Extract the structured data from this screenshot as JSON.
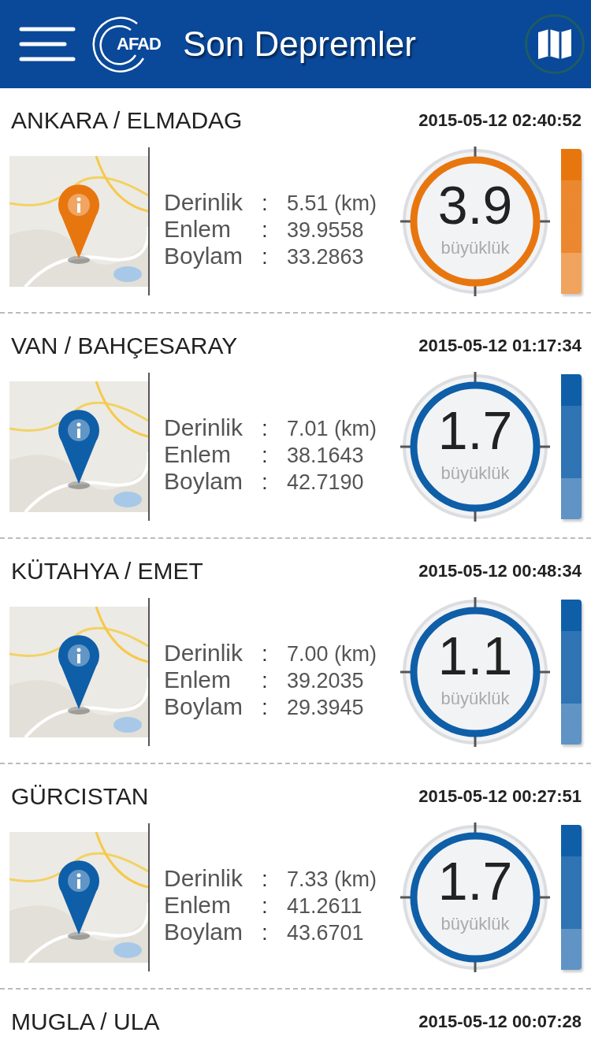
{
  "header": {
    "logo_text": "AFAD",
    "title": "Son Depremler"
  },
  "quakes": [
    {
      "place": "ANKARA / ELMADAG",
      "time": "2015-05-12 02:40:52",
      "color": "#e8760f",
      "fields": [
        {
          "label": "Derinlik",
          "sep": ":",
          "value": "5.51 (km)"
        },
        {
          "label": "Enlem",
          "sep": ":",
          "value": "39.9558"
        },
        {
          "label": "Boylam",
          "sep": ":",
          "value": "33.2863"
        }
      ],
      "magnitude": "3.9",
      "magnitude_label": "büyüklük"
    },
    {
      "place": "VAN / BAHÇESARAY",
      "time": "2015-05-12 01:17:34",
      "color": "#0f5ea8",
      "fields": [
        {
          "label": "Derinlik",
          "sep": ":",
          "value": "7.01 (km)"
        },
        {
          "label": "Enlem",
          "sep": ":",
          "value": "38.1643"
        },
        {
          "label": "Boylam",
          "sep": ":",
          "value": "42.7190"
        }
      ],
      "magnitude": "1.7",
      "magnitude_label": "büyüklük"
    },
    {
      "place": "KÜTAHYA / EMET",
      "time": "2015-05-12 00:48:34",
      "color": "#0f5ea8",
      "fields": [
        {
          "label": "Derinlik",
          "sep": ":",
          "value": "7.00 (km)"
        },
        {
          "label": "Enlem",
          "sep": ":",
          "value": "39.2035"
        },
        {
          "label": "Boylam",
          "sep": ":",
          "value": "29.3945"
        }
      ],
      "magnitude": "1.1",
      "magnitude_label": "büyüklük"
    },
    {
      "place": "GÜRCISTAN",
      "time": "2015-05-12 00:27:51",
      "color": "#0f5ea8",
      "fields": [
        {
          "label": "Derinlik",
          "sep": ":",
          "value": "7.33 (km)"
        },
        {
          "label": "Enlem",
          "sep": ":",
          "value": "41.2611"
        },
        {
          "label": "Boylam",
          "sep": ":",
          "value": "43.6701"
        }
      ],
      "magnitude": "1.7",
      "magnitude_label": "büyüklük"
    },
    {
      "place": "MUGLA / ULA",
      "time": "2015-05-12 00:07:28"
    }
  ]
}
